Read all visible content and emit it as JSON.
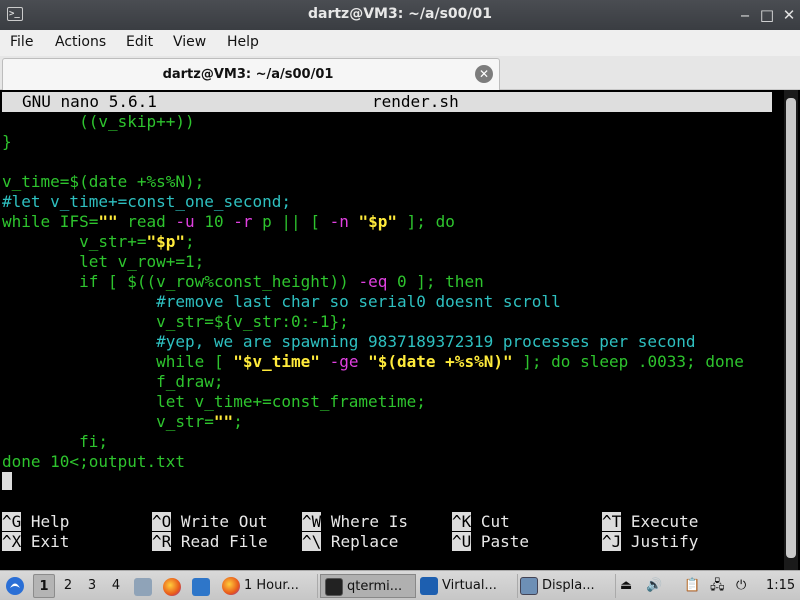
{
  "window": {
    "title": "dartz@VM3: ~/a/s00/01",
    "app_icon_glyph": ">_",
    "controls": {
      "minimize": "‒",
      "maximize": "□",
      "close": "✕"
    }
  },
  "menu": [
    "File",
    "Actions",
    "Edit",
    "View",
    "Help"
  ],
  "tab": {
    "label": "dartz@VM3: ~/a/s00/01",
    "close_glyph": "✕"
  },
  "nano": {
    "version": "GNU nano 5.6.1",
    "filename": "render.sh",
    "lines": [
      "        ((v_skip++))",
      "}",
      "",
      "v_time=$(date +%s%N);",
      "#let v_time+=const_one_second;",
      "while IFS=\"\" read -u 10 -r p || [ -n \"$p\" ]; do",
      "        v_str+=\"$p\";",
      "        let v_row+=1;",
      "        if [ $((v_row%const_height)) -eq 0 ]; then",
      "                #remove last char so serial0 doesnt scroll",
      "                v_str=${v_str:0:-1};",
      "                #yep, we are spawning 9837189372319 processes per second",
      "                while [ \"$v_time\" -ge \"$(date +%s%N)\" ]; do sleep .0033; done",
      "                f_draw;",
      "                let v_time+=const_frametime;",
      "                v_str=\"\";",
      "        fi;",
      "done 10<output.txt"
    ],
    "shortcuts": [
      {
        "key": "^G",
        "label": "Help"
      },
      {
        "key": "^O",
        "label": "Write Out"
      },
      {
        "key": "^W",
        "label": "Where Is"
      },
      {
        "key": "^K",
        "label": "Cut"
      },
      {
        "key": "^T",
        "label": "Execute"
      },
      {
        "key": "^X",
        "label": "Exit"
      },
      {
        "key": "^R",
        "label": "Read File"
      },
      {
        "key": "^\\",
        "label": "Replace"
      },
      {
        "key": "^U",
        "label": "Paste"
      },
      {
        "key": "^J",
        "label": "Justify"
      }
    ]
  },
  "taskbar": {
    "workspaces": [
      "1",
      "2",
      "3",
      "4"
    ],
    "active_workspace": "1",
    "tasks": [
      {
        "label": "1 Hour...",
        "icon": "firefox-icon"
      },
      {
        "label": "qtermi...",
        "icon": "terminal-icon"
      },
      {
        "label": "Virtual...",
        "icon": "virtualbox-icon"
      },
      {
        "label": "Displa...",
        "icon": "display-icon"
      }
    ],
    "clock": "1:15"
  }
}
